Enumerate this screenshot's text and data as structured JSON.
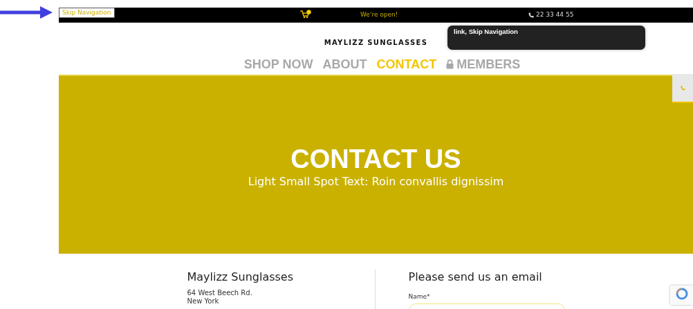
{
  "skip_link": {
    "label": "Skip Navigation"
  },
  "top_bar": {
    "open_text": "We're open!",
    "phone": "22 33 44 55"
  },
  "tooltip": {
    "text": "link, Skip Navigation"
  },
  "logo": "MAYLIZZ SUNGLASSES",
  "nav": [
    {
      "label": "SHOP NOW",
      "selected": false,
      "kind": "link"
    },
    {
      "label": "ABOUT",
      "selected": false,
      "kind": "link"
    },
    {
      "label": "CONTACT",
      "selected": true,
      "kind": "link"
    },
    {
      "label": "MEMBERS",
      "selected": false,
      "kind": "locked"
    }
  ],
  "hero": {
    "title": "CONTACT US",
    "subtitle": "Light Small Spot Text: Roin convallis dignissim"
  },
  "contact": {
    "company": "Maylizz Sunglasses",
    "address": [
      "64 West Beech Rd.",
      "New York"
    ]
  },
  "form": {
    "title": "Please send us an email",
    "fields": [
      {
        "label": "Name*"
      }
    ]
  }
}
